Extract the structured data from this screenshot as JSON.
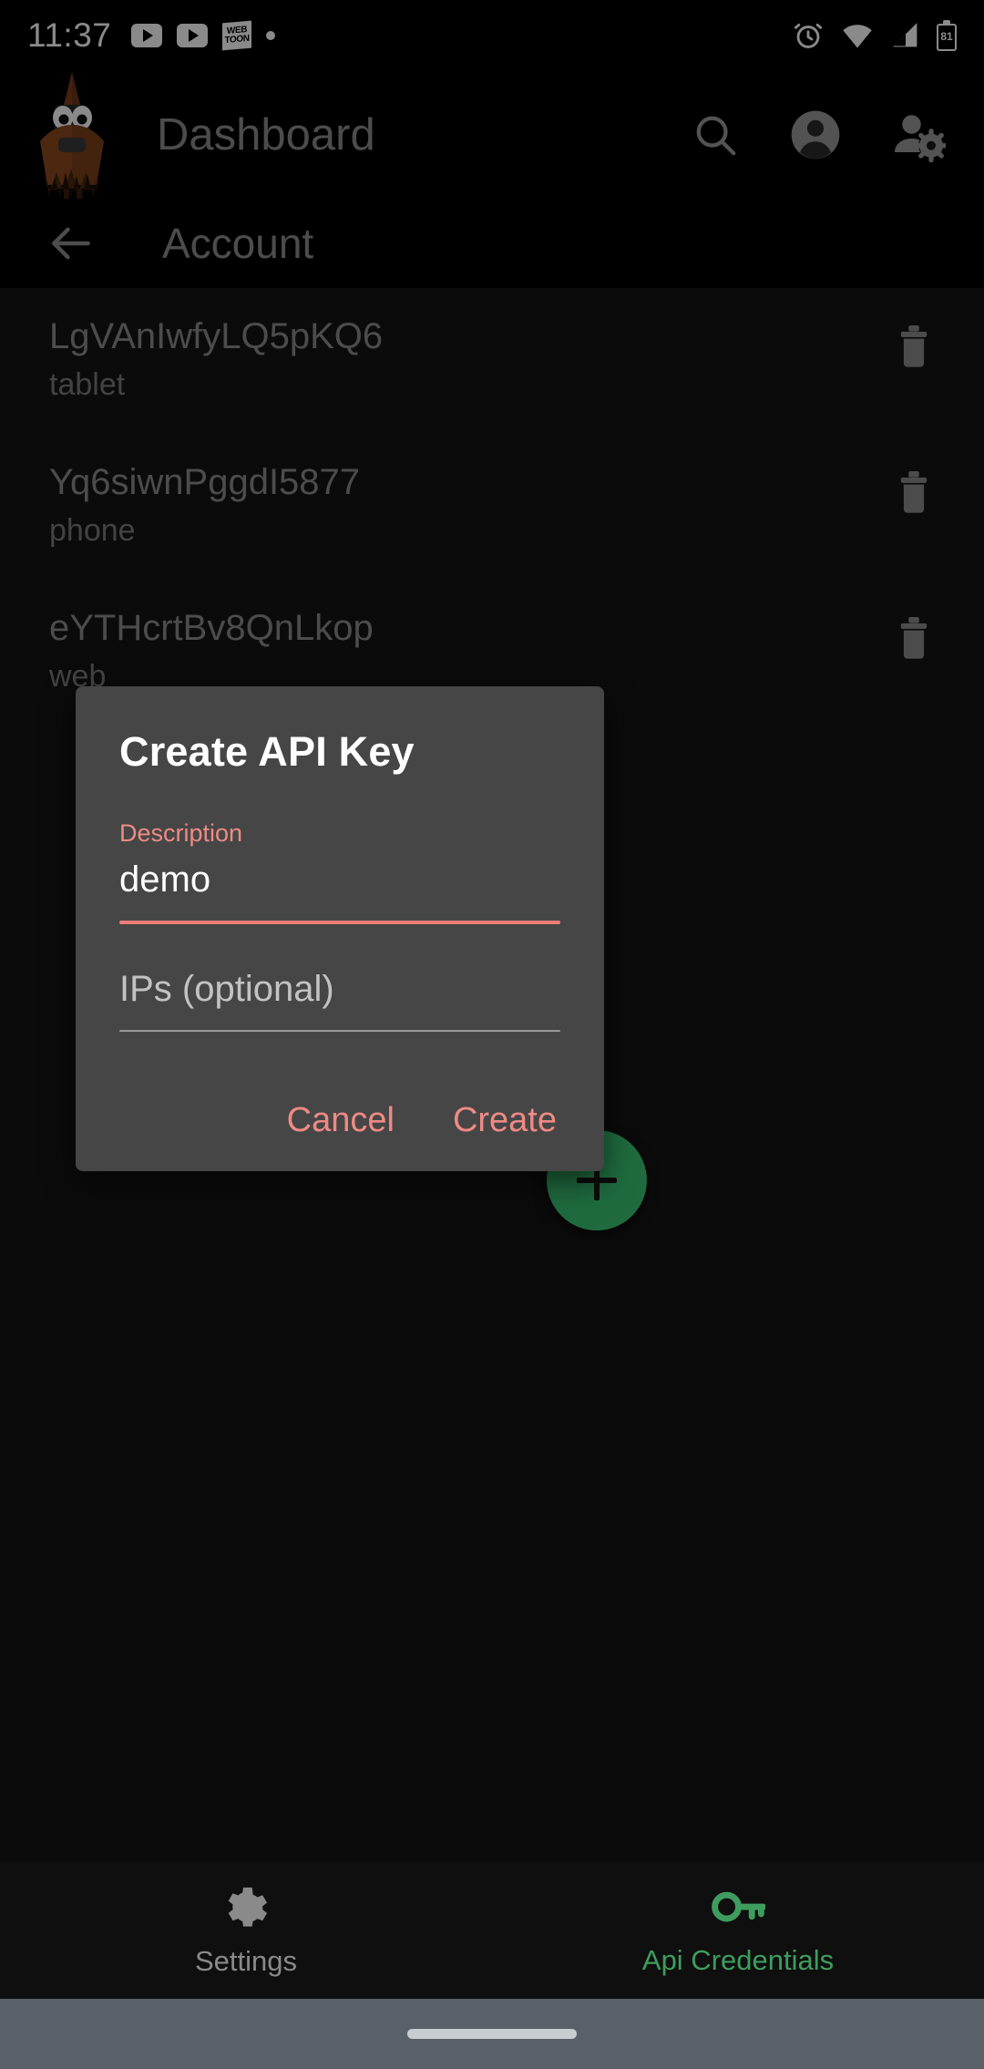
{
  "status_bar": {
    "time": "11:37",
    "battery_level": "81",
    "left_icons": [
      "youtube-icon",
      "youtube-icon",
      "webtoon-icon",
      "dot-indicator"
    ],
    "right_icons": [
      "alarm-icon",
      "wifi-icon",
      "signal-icon",
      "battery-icon"
    ],
    "webtoon_line1": "WEB",
    "webtoon_line2": "TOON"
  },
  "app_bar": {
    "title": "Dashboard",
    "logo_name": "app-logo-bird",
    "actions": [
      {
        "name": "search-icon"
      },
      {
        "name": "account-circle-icon"
      },
      {
        "name": "manage-accounts-icon"
      }
    ]
  },
  "sub_bar": {
    "back_icon": "back-arrow-icon",
    "title": "Account"
  },
  "list": {
    "items": [
      {
        "title": "LgVAnIwfyLQ5pKQ6",
        "subtitle": "tablet",
        "delete_icon": "trash-icon"
      },
      {
        "title": "Yq6siwnPggdI5877",
        "subtitle": "phone",
        "delete_icon": "trash-icon"
      },
      {
        "title": "eYTHcrtBv8QnLkop",
        "subtitle": "web",
        "delete_icon": "trash-icon"
      }
    ]
  },
  "fab": {
    "name": "add-api-key-fab",
    "icon": "plus-icon",
    "color": "#1f6b3f"
  },
  "bottom_nav": {
    "items": [
      {
        "label": "Settings",
        "icon": "gear-icon",
        "active": false,
        "color": "#8a8a8a"
      },
      {
        "label": "Api Credentials",
        "icon": "key-icon",
        "active": true,
        "color": "#3e9d5e"
      }
    ]
  },
  "dialog": {
    "title": "Create API Key",
    "fields": [
      {
        "label": "Description",
        "value": "demo",
        "placeholder": "Description",
        "focused": true
      },
      {
        "label": "IPs (optional)",
        "value": "",
        "placeholder": "IPs (optional)",
        "focused": false
      }
    ],
    "cancel_label": "Cancel",
    "create_label": "Create",
    "accent_color": "#ef8a84"
  }
}
